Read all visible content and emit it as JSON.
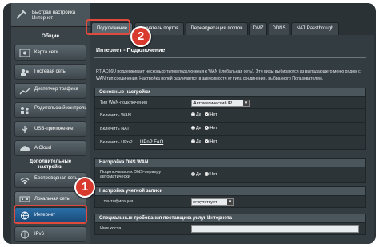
{
  "sidebar": {
    "quick_setup": "Быстрая настройка Интернет",
    "general_header": "Общие",
    "items": [
      {
        "label": "Карта сети",
        "icon": "network-map-icon"
      },
      {
        "label": "Гостевая сеть",
        "icon": "guest-network-icon"
      },
      {
        "label": "Диспетчер трафика",
        "icon": "traffic-manager-icon"
      },
      {
        "label": "Родительский контроль",
        "icon": "parental-control-icon"
      },
      {
        "label": "USB-приложение",
        "icon": "usb-icon"
      },
      {
        "label": "AiCloud",
        "icon": "cloud-icon"
      }
    ],
    "advanced_header": "Дополнительные настройки",
    "advanced_items": [
      {
        "label": "Беспроводная сеть",
        "icon": "wireless-icon"
      },
      {
        "label": "Локальная сеть",
        "icon": "lan-icon"
      },
      {
        "label": "Интернет",
        "icon": "globe-icon"
      },
      {
        "label": "IPv6",
        "icon": "ipv6-icon"
      }
    ]
  },
  "tabs": [
    {
      "label": "Подключение"
    },
    {
      "label": "...ючатель портов"
    },
    {
      "label": "Переадресация портов"
    },
    {
      "label": "DMZ"
    },
    {
      "label": "DDNS"
    },
    {
      "label": "NAT Passthrough"
    }
  ],
  "page": {
    "title": "Интернет - Подключение",
    "description": "RT-AC66U поддерживает несколько типов подключения к WAN (глобальная сеть). Эти виды выбираются из выпадающего меню рядом с WAN тип соединения. Настройка полей различается в зависимости от типа соединения, выбранного Пользователем."
  },
  "basic_section": {
    "header": "Основные настройки",
    "wan_type_label": "Тип WAN-подключения",
    "wan_type_value": "Автоматический IP",
    "enable_wan_label": "Включить WAN",
    "enable_nat_label": "Включить NAT",
    "enable_upnp_label": "Включить UPnP",
    "upnp_faq": "UPnP  FAQ",
    "yes": "Да",
    "no": "Нет"
  },
  "dns_section": {
    "header": "Настройка DNS WAN",
    "auto_dns_label": "Подключаться к DNS-серверу автоматически",
    "yes": "Да",
    "no": "Нет"
  },
  "account_section": {
    "header": "Настройка учетной записи",
    "auth_label": "...тентификация",
    "auth_value": "отсутствует"
  },
  "isp_section": {
    "header": "Специальные требования поставщика услуг Интернета",
    "host_label": "Имя хоста"
  },
  "annotations": {
    "one": "1",
    "two": "2"
  }
}
